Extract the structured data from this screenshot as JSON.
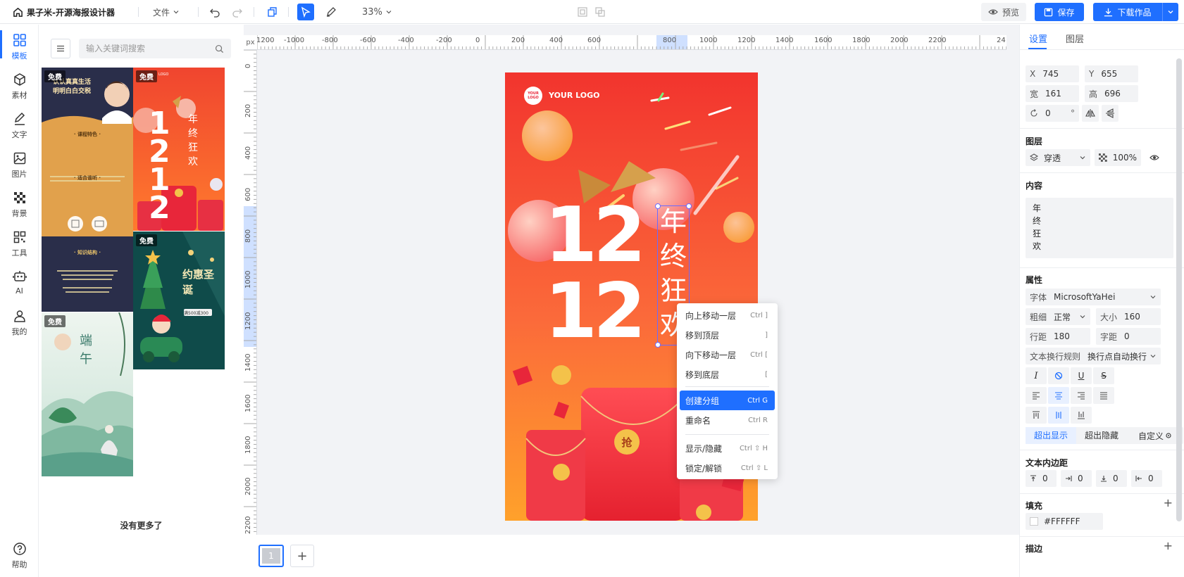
{
  "app": {
    "title": "果子米-开源海报设计器",
    "file_menu": "文件",
    "zoom": "33%"
  },
  "toolbar": {
    "preview": "预览",
    "save": "保存",
    "download": "下载作品"
  },
  "nav": [
    {
      "key": "template",
      "label": "模板"
    },
    {
      "key": "material",
      "label": "素材"
    },
    {
      "key": "text",
      "label": "文字"
    },
    {
      "key": "image",
      "label": "图片"
    },
    {
      "key": "background",
      "label": "背景"
    },
    {
      "key": "tools",
      "label": "工具"
    },
    {
      "key": "ai",
      "label": "AI"
    },
    {
      "key": "mine",
      "label": "我的"
    },
    {
      "key": "help",
      "label": "帮助"
    }
  ],
  "search": {
    "placeholder": "输入关键词搜索"
  },
  "templates": [
    {
      "badge": "免费",
      "headline": "认认真真生活\n明明白白交税",
      "sub1": "· 课程特色 ·",
      "sub2": "· 适合谁听 ·",
      "sub3": "· 知识结构 ·"
    },
    {
      "badge": "免费",
      "logo": "LOGO",
      "big": "12 12",
      "vert": "年终狂欢"
    },
    {
      "badge": "免费",
      "title": "约惠圣诞",
      "price": "满500减300"
    },
    {
      "badge": "免费",
      "title": "端午"
    }
  ],
  "no_more": "没有更多了",
  "ruler": {
    "unit": "px",
    "top": [
      "1200",
      "-1000",
      "-800",
      "-600",
      "-400",
      "-200",
      "0",
      "200",
      "400",
      "600",
      "800",
      "1000",
      "1200",
      "1400",
      "1600",
      "1800",
      "2000",
      "2200",
      "24"
    ],
    "left": [
      "0",
      "200",
      "400",
      "600",
      "800",
      "1000",
      "1200",
      "1400",
      "1600",
      "1800",
      "2000",
      "2200"
    ]
  },
  "poster": {
    "logo_badge": "YOUR\nLOGO",
    "logo_text": "YOUR LOGO",
    "big_num": "12",
    "vertical": [
      "年",
      "终",
      "狂",
      "欢"
    ],
    "envelope_char": "抢"
  },
  "context_menu": [
    {
      "label": "向上移动一层",
      "shortcut": "Ctrl ]"
    },
    {
      "label": "移到顶层",
      "shortcut": "]"
    },
    {
      "label": "向下移动一层",
      "shortcut": "Ctrl ["
    },
    {
      "label": "移到底层",
      "shortcut": "["
    },
    {
      "label": "创建分组",
      "shortcut": "Ctrl G"
    },
    {
      "label": "重命名",
      "shortcut": "Ctrl R"
    },
    {
      "label": "显示/隐藏",
      "shortcut": "Ctrl ⇧ H"
    },
    {
      "label": "锁定/解锁",
      "shortcut": "Ctrl ⇧ L"
    }
  ],
  "page": {
    "current": "1",
    "add": "+"
  },
  "panel": {
    "tabs": [
      "设置",
      "图层"
    ],
    "x_label": "X",
    "x": "745",
    "y_label": "Y",
    "y": "655",
    "w_label": "宽",
    "w": "161",
    "h_label": "高",
    "h": "696",
    "rotate": "0",
    "rotate_unit": "°",
    "layer_title": "图层",
    "blend": "穿透",
    "opacity": "100",
    "opacity_unit": "%",
    "content_title": "内容",
    "content": "年\n终\n狂\n欢",
    "attr_title": "属性",
    "font_label": "字体",
    "font": "MicrosoftYaHei",
    "weight_label": "粗细",
    "weight": "正常",
    "size_label": "大小",
    "size": "160",
    "line_label": "行距",
    "line": "180",
    "letter_label": "字距",
    "letter": "0",
    "wrap_label": "文本换行规则",
    "wrap": "换行点自动换行",
    "overflow_show": "超出显示",
    "overflow_hide": "超出隐藏",
    "custom": "自定义",
    "padding_title": "文本内边距",
    "padding": [
      "0",
      "0",
      "0",
      "0"
    ],
    "fill_title": "填充",
    "fill_color": "#FFFFFF",
    "stroke_title": "描边"
  },
  "colors": {
    "accent": "#1f6fff"
  }
}
